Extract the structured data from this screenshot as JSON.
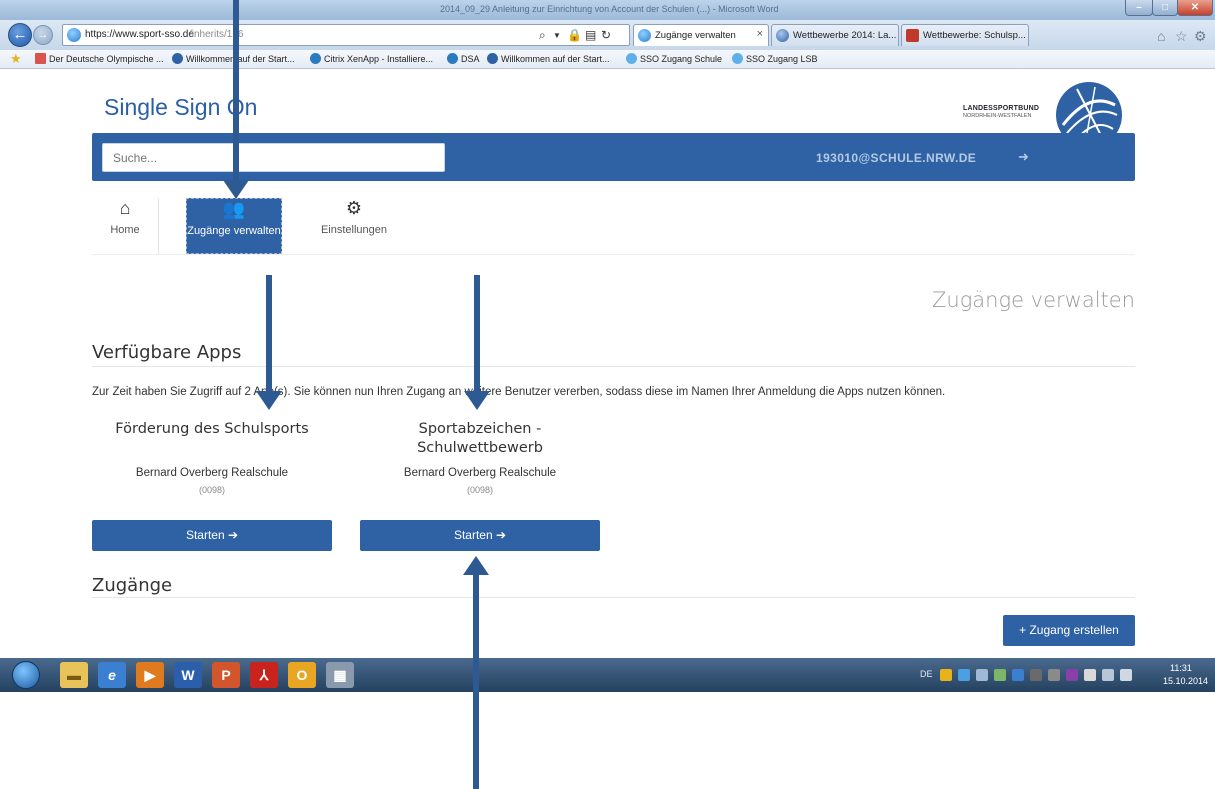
{
  "browser": {
    "window_title": "2014_09_29 Anleitung zur Einrichtung von Account der Schulen (...) - Microsoft Word",
    "url_host": "https://www.sport-sso.de",
    "url_path": "/inherits/126",
    "tabs": [
      {
        "label": "Zugänge verwalten",
        "active": true
      },
      {
        "label": "Wettbewerbe 2014: La...",
        "active": false
      },
      {
        "label": "Wettbewerbe: Schulsp...",
        "active": false
      }
    ],
    "favorites": [
      "Der Deutsche Olympische ...",
      "Willkommen auf der Start...",
      "Citrix XenApp - Installiere...",
      "DSA",
      "Willkommen auf der Start...",
      "SSO Zugang Schule",
      "SSO Zugang LSB"
    ]
  },
  "header": {
    "brand": "Single Sign On",
    "lsb_line1": "LANDESSPORTBUND",
    "lsb_line2": "NORDRHEIN-WESTFALEN",
    "search_placeholder": "Suche...",
    "user_email": "193010@SCHULE.NRW.DE"
  },
  "nav": {
    "home": "Home",
    "access": "Zugänge verwalten",
    "settings": "Einstellungen"
  },
  "main": {
    "page_heading": "Zugänge verwalten",
    "section_apps": "Verfügbare Apps",
    "intro": "Zur Zeit haben Sie Zugriff auf 2 App(s). Sie können nun Ihren Zugang an weitere Benutzer vererben, sodass diese im Namen Ihrer Anmeldung die Apps nutzen können.",
    "apps": [
      {
        "title": "Förderung des Schulsports",
        "school": "Bernard Overberg Realschule",
        "code": "(0098)",
        "button": "Starten ➔"
      },
      {
        "title": "Sportabzeichen - Schulwettbewerb",
        "school": "Bernard Overberg Realschule",
        "code": "(0098)",
        "button": "Starten ➔"
      }
    ],
    "section_access": "Zugänge",
    "create_button": "+ Zugang erstellen"
  },
  "taskbar": {
    "language": "DE",
    "time": "11:31",
    "date": "15.10.2014"
  }
}
